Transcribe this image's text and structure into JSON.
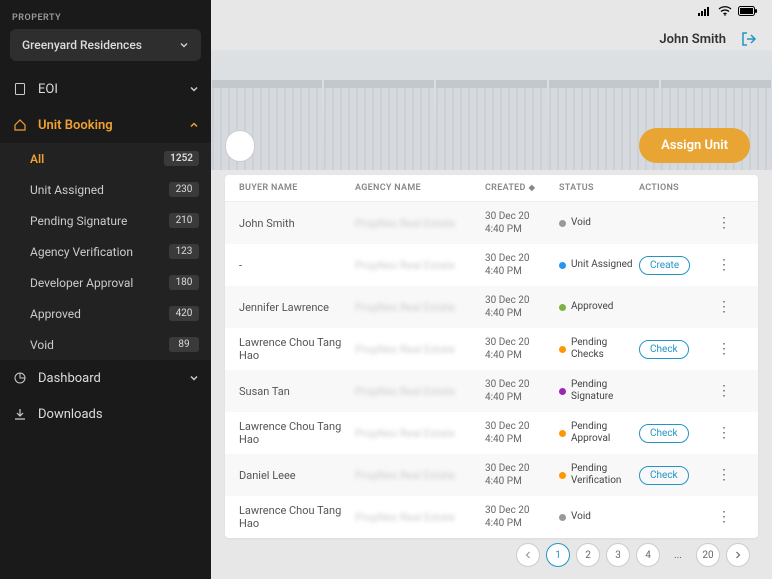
{
  "sidebar": {
    "property_label": "PROPERTY",
    "property_name": "Greenyard Residences",
    "nav": {
      "eoi": "EOI",
      "unit_booking": "Unit Booking",
      "dashboard": "Dashboard",
      "downloads": "Downloads"
    },
    "booking_items": [
      {
        "label": "All",
        "count": "1252",
        "selected": true
      },
      {
        "label": "Unit Assigned",
        "count": "230"
      },
      {
        "label": "Pending Signature",
        "count": "210"
      },
      {
        "label": "Agency Verification",
        "count": "123"
      },
      {
        "label": "Developer Approval",
        "count": "180"
      },
      {
        "label": "Approved",
        "count": "420"
      },
      {
        "label": "Void",
        "count": "89"
      }
    ]
  },
  "header": {
    "user_name": "John Smith"
  },
  "buttons": {
    "assign_unit": "Assign  Unit"
  },
  "table": {
    "headers": {
      "buyer": "BUYER NAME",
      "agency": "AGENCY NAME",
      "created": "CREATED",
      "status": "STATUS",
      "actions": "ACTIONS"
    },
    "rows": [
      {
        "buyer": "John Smith",
        "agency": "PropNex Real Estate",
        "created_date": "30 Dec 20",
        "created_time": "4:40 PM",
        "status": "Void",
        "dot": "#999",
        "action": ""
      },
      {
        "buyer": "-",
        "agency": "PropNex Real Estate",
        "created_date": "30 Dec 20",
        "created_time": "4:40 PM",
        "status": "Unit Assigned",
        "dot": "#2196f3",
        "action": "Create"
      },
      {
        "buyer": "Jennifer Lawrence",
        "agency": "PropNex Real Estate",
        "created_date": "30 Dec 20",
        "created_time": "4:40 PM",
        "status": "Approved",
        "dot": "#7cb342",
        "action": ""
      },
      {
        "buyer": "Lawrence  Chou Tang Hao",
        "agency": "PropNex Real Estate",
        "created_date": "30 Dec 20",
        "created_time": "4:40 PM",
        "status": "Pending Checks",
        "dot": "#ff9800",
        "action": "Check"
      },
      {
        "buyer": "Susan Tan",
        "agency": "PropNex Real Estate",
        "created_date": "30 Dec 20",
        "created_time": "4:40 PM",
        "status": "Pending Signature",
        "dot": "#9c27b0",
        "action": ""
      },
      {
        "buyer": "Lawrence Chou Tang Hao",
        "agency": "PropNex Real Estate",
        "created_date": "30 Dec 20",
        "created_time": "4:40 PM",
        "status": "Pending Approval",
        "dot": "#ff9800",
        "action": "Check"
      },
      {
        "buyer": "Daniel Leee",
        "agency": "PropNex Real Estate",
        "created_date": "30 Dec 20",
        "created_time": "4:40 PM",
        "status": "Pending Verification",
        "dot": "#ff9800",
        "action": "Check"
      },
      {
        "buyer": "Lawrence Chou Tang Hao",
        "agency": "PropNex Real Estate",
        "created_date": "30 Dec 20",
        "created_time": "4:40 PM",
        "status": "Void",
        "dot": "#999",
        "action": ""
      }
    ]
  },
  "pagination": {
    "pages": [
      "1",
      "2",
      "3",
      "4",
      "...",
      "20"
    ]
  }
}
